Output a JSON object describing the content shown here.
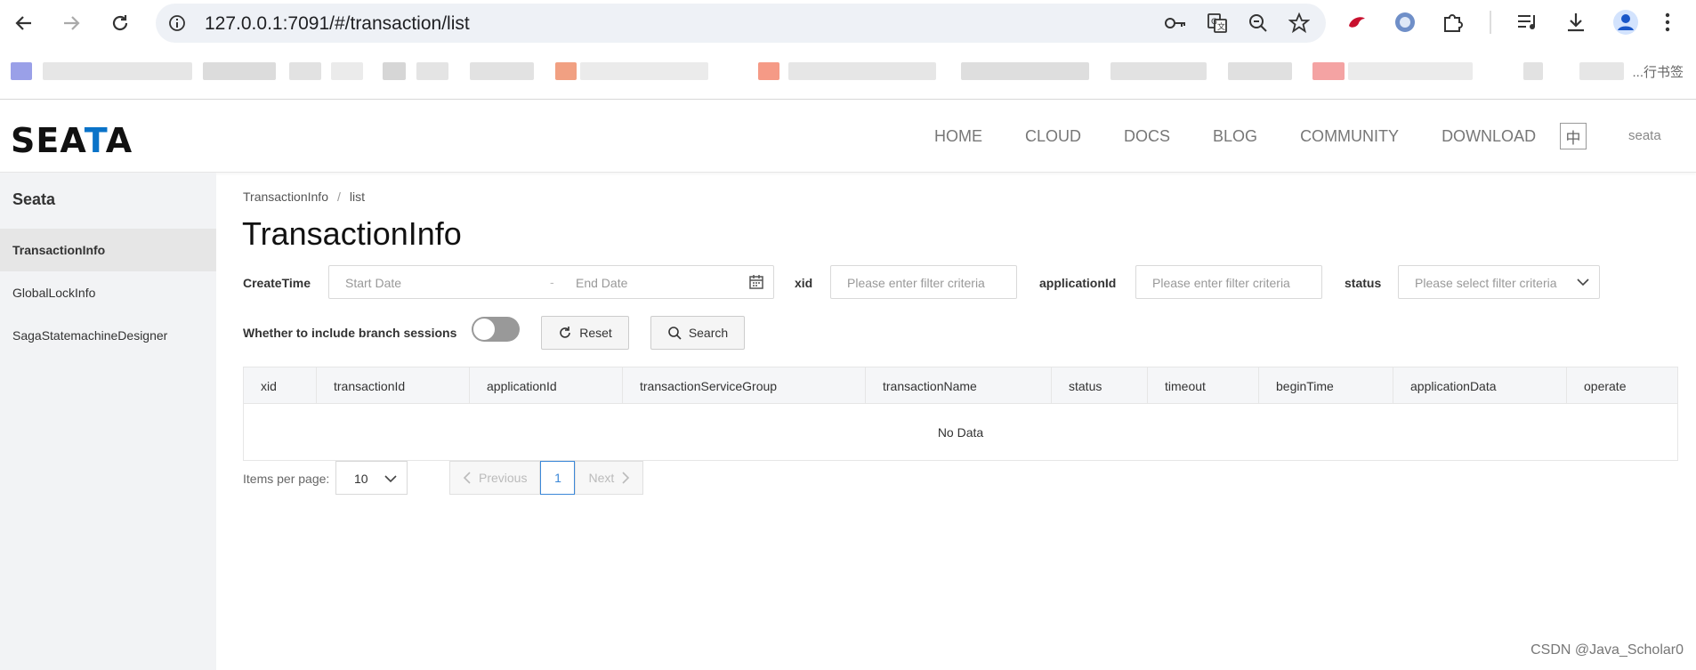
{
  "browser": {
    "url": "127.0.0.1:7091/#/transaction/list",
    "bookmarks_trailing_text": "...行书签"
  },
  "header": {
    "logo": {
      "pre": "SE",
      "mid": "A",
      "t": "T",
      "post": "A"
    },
    "nav": [
      "HOME",
      "CLOUD",
      "DOCS",
      "BLOG",
      "COMMUNITY",
      "DOWNLOAD"
    ],
    "lang": "中",
    "user": "seata"
  },
  "sidebar": {
    "title": "Seata",
    "items": [
      {
        "label": "TransactionInfo"
      },
      {
        "label": "GlobalLockInfo"
      },
      {
        "label": "SagaStatemachineDesigner"
      }
    ]
  },
  "main": {
    "breadcrumb": {
      "root": "TransactionInfo",
      "sep": "/",
      "current": "list"
    },
    "title": "TransactionInfo",
    "filters": {
      "createtime_label": "CreateTime",
      "start_placeholder": "Start Date",
      "range_sep": "-",
      "end_placeholder": "End Date",
      "xid_label": "xid",
      "xid_placeholder": "Please enter filter criteria",
      "appid_label": "applicationId",
      "appid_placeholder": "Please enter filter criteria",
      "status_label": "status",
      "status_placeholder": "Please select filter criteria",
      "branch_label": "Whether to include branch sessions",
      "branch_toggle": false,
      "reset_label": "Reset",
      "search_label": "Search"
    },
    "table": {
      "columns": [
        "xid",
        "transactionId",
        "applicationId",
        "transactionServiceGroup",
        "transactionName",
        "status",
        "timeout",
        "beginTime",
        "applicationData",
        "operate"
      ],
      "empty_text": "No Data"
    },
    "pagination": {
      "items_per_page_label": "Items per page:",
      "page_size": "10",
      "prev_label": "Previous",
      "current_page": "1",
      "next_label": "Next"
    }
  },
  "watermark": "CSDN @Java_Scholar0"
}
